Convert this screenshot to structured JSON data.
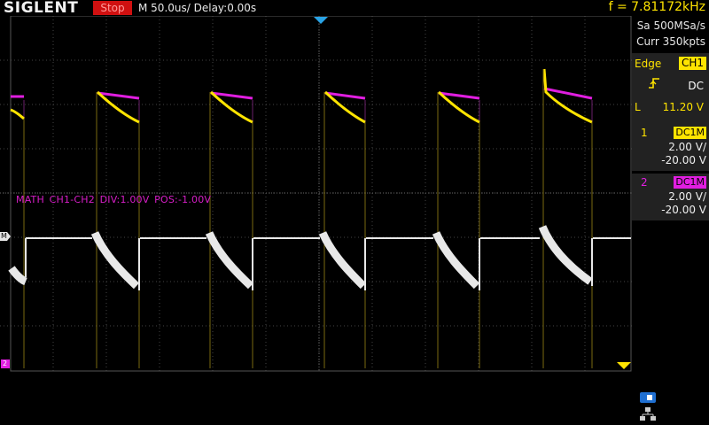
{
  "header": {
    "brand": "SIGLENT",
    "run_state": "Stop",
    "timebase": "M 50.0us/",
    "delay": "Delay:0.00s",
    "frequency": "f = 7.81172kHz"
  },
  "acquisition": {
    "sample_rate": "Sa 500MSa/s",
    "memory_depth": "Curr 350kpts"
  },
  "trigger": {
    "type": "Edge",
    "source": "CH1",
    "slope_icon": "rising-edge-icon",
    "coupling": "DC",
    "level_label": "L",
    "level": "11.20 V"
  },
  "channels": [
    {
      "number": "1",
      "coupling": "DC1M",
      "scale": "2.00 V/",
      "offset": "-20.00 V",
      "color": "#ffe400"
    },
    {
      "number": "2",
      "coupling": "DC1M",
      "scale": "2.00 V/",
      "offset": "-20.00 V",
      "color": "#e01ee0"
    }
  ],
  "math": {
    "label": "MATH  CH1-CH2  DIV:1.00V  POS:-1.00V",
    "marker": "M",
    "color": "#e8e8e8"
  },
  "markers": {
    "trigger_position": "trigger-position-marker",
    "trigger_level": "trigger-level-marker",
    "ch2_ground": "2"
  },
  "status_icons": [
    "usb-icon",
    "lan-icon"
  ]
}
